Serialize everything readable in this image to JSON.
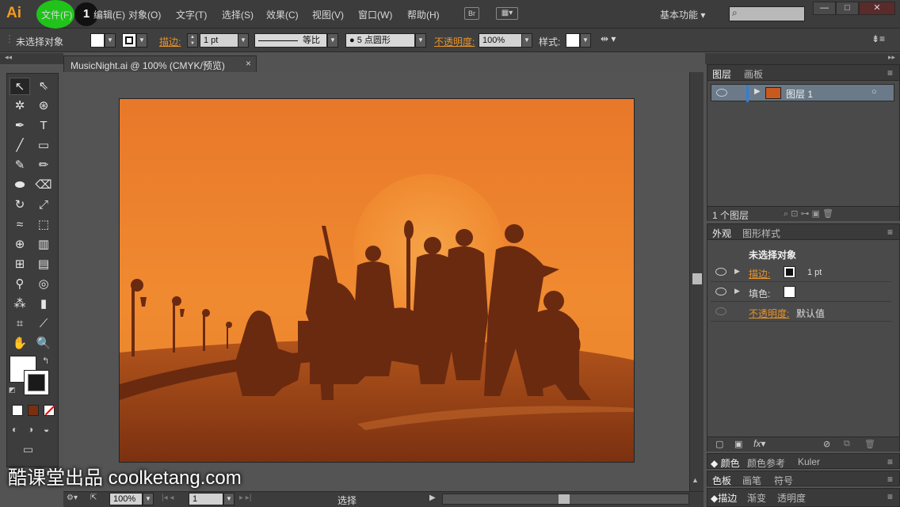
{
  "app": {
    "logo": "Ai",
    "tutorial_step": "1",
    "workspace": "基本功能",
    "bridge_label": "Br"
  },
  "menu": [
    "文件(F)",
    "编辑(E)",
    "对象(O)",
    "文字(T)",
    "选择(S)",
    "效果(C)",
    "视图(V)",
    "窗口(W)",
    "帮助(H)"
  ],
  "control_bar": {
    "selection_status": "未选择对象",
    "stroke_label": "描边:",
    "stroke_weight": "1 pt",
    "stroke_profile": "等比",
    "brush": "5 点圆形",
    "opacity_label": "不透明度:",
    "opacity_value": "100%",
    "style_label": "样式:"
  },
  "document": {
    "tab_title": "MusicNight.ai @ 100% (CMYK/预览)",
    "close": "×"
  },
  "status_bar": {
    "zoom": "100%",
    "artboard_number": "1",
    "tool": "选择"
  },
  "layers_panel": {
    "tabs": [
      "图层",
      "画板"
    ],
    "layer_name": "图层 1",
    "count": "1 个图层"
  },
  "appearance_panel": {
    "tabs": [
      "外观",
      "图形样式"
    ],
    "title": "未选择对象",
    "stroke_label": "描边:",
    "stroke_value": "1 pt",
    "fill_label": "填色:",
    "opacity_label": "不透明度:",
    "opacity_value": "默认值"
  },
  "color_panel_1": {
    "tabs": [
      "颜色",
      "颜色参考",
      "Kuler"
    ]
  },
  "color_panel_2": {
    "tabs": [
      "色板",
      "画笔",
      "符号"
    ]
  },
  "color_panel_3": {
    "tabs": [
      "描边",
      "渐变",
      "透明度"
    ]
  },
  "watermark": "酷课堂出品 coolketang.com",
  "colors": {
    "artboard_top": "#e8782a",
    "artboard_bottom": "#7a3010",
    "silhouette": "#6a2a10",
    "accent_orange": "#e8932a",
    "highlight_green": "#1fc31a"
  }
}
